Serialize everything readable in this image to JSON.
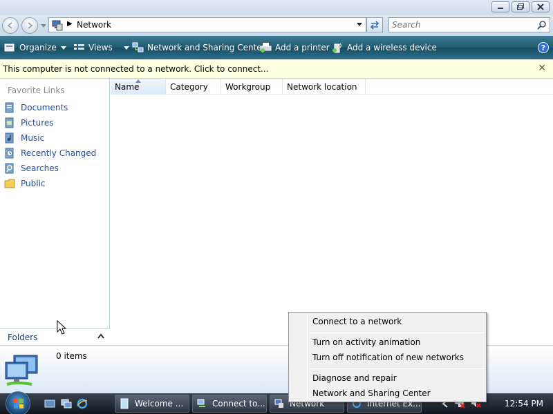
{
  "window": {
    "controls": [
      "minimize-icon",
      "maximize-icon",
      "close-icon"
    ]
  },
  "address": {
    "breadcrumb": "Network",
    "search_placeholder": "Search"
  },
  "toolbar": {
    "organize_label": "Organize",
    "views_label": "Views",
    "network_sharing_label": "Network and Sharing Center",
    "add_printer_label": "Add a printer",
    "add_wireless_label": "Add a wireless device",
    "help_label": "?"
  },
  "infobar": {
    "message": "This computer is not connected to a network. Click to connect...",
    "close_label": "✕"
  },
  "navpane": {
    "header": "Favorite Links",
    "links": [
      {
        "label": "Documents",
        "icon": "documents-icon"
      },
      {
        "label": "Pictures",
        "icon": "pictures-icon"
      },
      {
        "label": "Music",
        "icon": "music-icon"
      },
      {
        "label": "Recently Changed",
        "icon": "recently-changed-icon"
      },
      {
        "label": "Searches",
        "icon": "searches-icon"
      },
      {
        "label": "Public",
        "icon": "public-folder-icon"
      }
    ],
    "folders_label": "Folders"
  },
  "columns": [
    "Name",
    "Category",
    "Workgroup",
    "Network location"
  ],
  "details": {
    "item_count": "0 items"
  },
  "context_menu": {
    "items": [
      "Connect to a network",
      "Turn on activity animation",
      "Turn off notification of new networks",
      "Diagnose and repair",
      "Network and Sharing Center"
    ]
  },
  "taskbar": {
    "tasks": [
      "Welcome ...",
      "Connect to...",
      "Network",
      "Internet Ex..."
    ],
    "clock": "12:54 PM"
  },
  "colors": {
    "link": "#1e4fa8",
    "commandbar": "#1f5a72",
    "infobar": "#ffffe1"
  }
}
